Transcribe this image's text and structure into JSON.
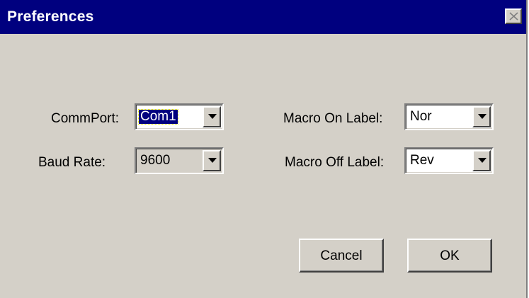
{
  "window": {
    "title": "Preferences"
  },
  "fields": {
    "commport": {
      "label": "CommPort:",
      "value": "Com1"
    },
    "baud_rate": {
      "label": "Baud Rate:",
      "value": "9600"
    },
    "macro_on": {
      "label": "Macro On Label:",
      "value": "Nor"
    },
    "macro_off": {
      "label": "Macro Off Label:",
      "value": "Rev"
    }
  },
  "buttons": {
    "cancel": "Cancel",
    "ok": "OK"
  },
  "colors": {
    "title_bar": "#00007f",
    "dialog_face": "#d4d0c8",
    "selection": "#00007f"
  },
  "icons": {
    "close": "close-icon",
    "dropdown": "chevron-down-icon"
  }
}
